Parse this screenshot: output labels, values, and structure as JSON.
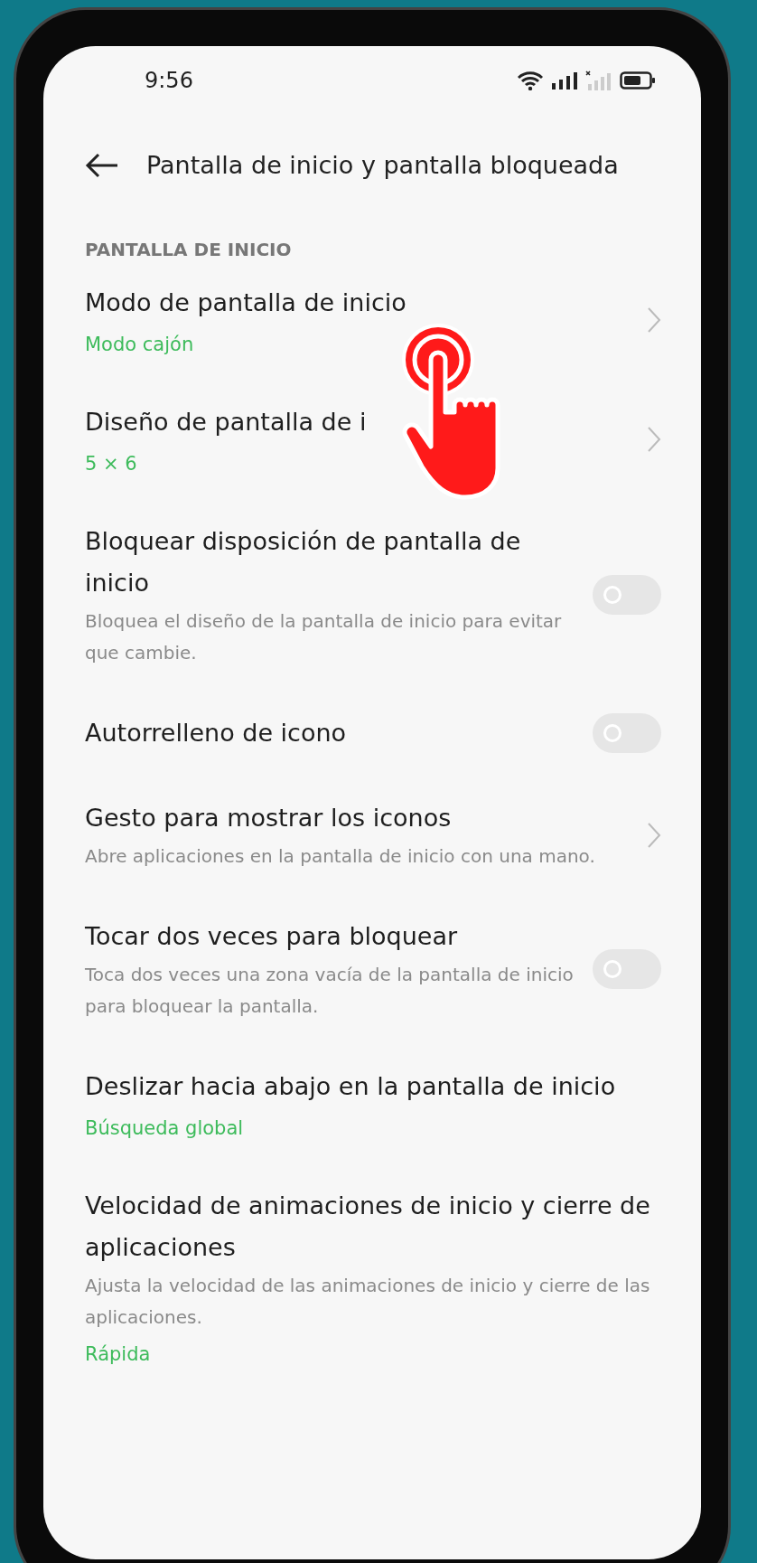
{
  "status_bar": {
    "time": "9:56"
  },
  "header": {
    "title": "Pantalla de inicio y pantalla bloqueada"
  },
  "section": {
    "title": "PANTALLA DE INICIO"
  },
  "items": [
    {
      "kind": "link",
      "title": "Modo de pantalla de inicio",
      "value": "Modo cajón"
    },
    {
      "kind": "link",
      "title": "Diseño de pantalla de i",
      "value": "5 × 6"
    },
    {
      "kind": "toggle",
      "title": "Bloquear disposición de pantalla de inicio",
      "description": "Bloquea el diseño de la pantalla de inicio para evitar que cambie.",
      "on": false
    },
    {
      "kind": "toggle",
      "title": "Autorrelleno de icono",
      "on": false
    },
    {
      "kind": "link",
      "title": "Gesto para mostrar los iconos",
      "description": "Abre aplicaciones en la pantalla de inicio con una mano."
    },
    {
      "kind": "toggle",
      "title": "Tocar dos veces para bloquear",
      "description": "Toca dos veces una zona vacía de la pantalla de inicio para bloquear la pantalla.",
      "on": false
    },
    {
      "kind": "plain",
      "title": "Deslizar hacia abajo en la pantalla de inicio",
      "value": "Búsqueda global"
    },
    {
      "kind": "plain",
      "title": "Velocidad de animaciones de inicio y cierre de aplicaciones",
      "description": "Ajusta la velocidad de las animaciones de inicio y cierre de las aplicaciones.",
      "value": "Rápida"
    }
  ]
}
